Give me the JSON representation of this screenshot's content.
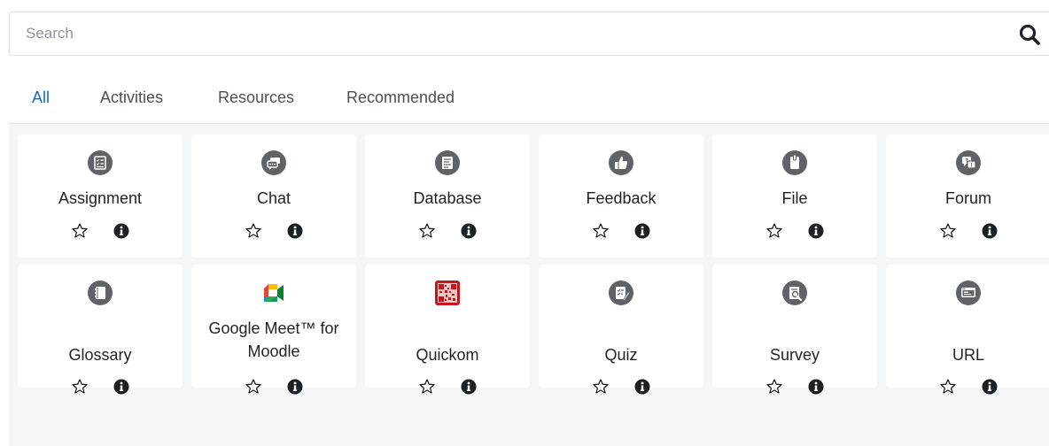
{
  "search": {
    "placeholder": "Search"
  },
  "tabs": [
    {
      "label": "All",
      "active": true
    },
    {
      "label": "Activities",
      "active": false
    },
    {
      "label": "Resources",
      "active": false
    },
    {
      "label": "Recommended",
      "active": false
    }
  ],
  "modules": [
    {
      "name": "Assignment",
      "icon": "assignment-icon"
    },
    {
      "name": "Chat",
      "icon": "chat-icon"
    },
    {
      "name": "Database",
      "icon": "database-icon"
    },
    {
      "name": "Feedback",
      "icon": "thumbs-up-icon"
    },
    {
      "name": "File",
      "icon": "file-icon"
    },
    {
      "name": "Forum",
      "icon": "forum-icon"
    },
    {
      "name": "Glossary",
      "icon": "glossary-icon"
    },
    {
      "name": "Google Meet™ for Moodle",
      "icon": "google-meet-icon"
    },
    {
      "name": "Quickom",
      "icon": "quickom-qr-icon"
    },
    {
      "name": "Quiz",
      "icon": "quiz-icon"
    },
    {
      "name": "Survey",
      "icon": "survey-icon"
    },
    {
      "name": "URL",
      "icon": "url-icon"
    }
  ],
  "colors": {
    "accent": "#0f6cbf",
    "icon_gray": "#5f6368",
    "content_bg": "#f5f6f7"
  }
}
